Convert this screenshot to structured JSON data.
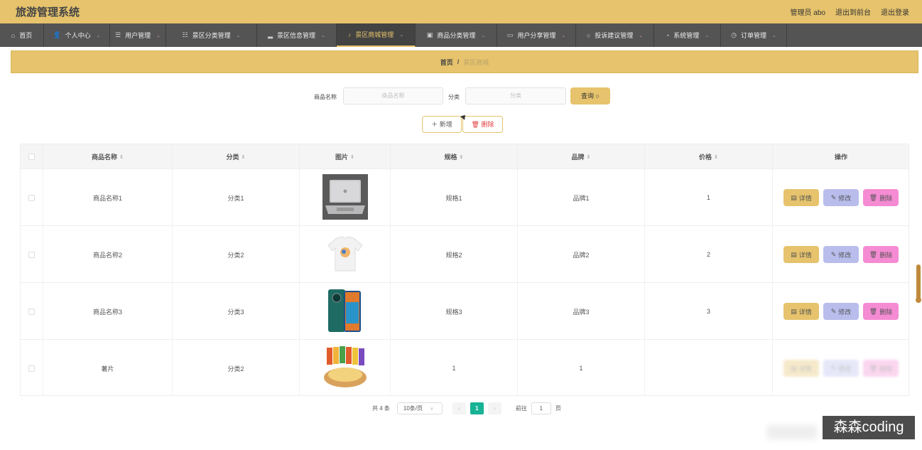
{
  "app": {
    "title": "旅游管理系统",
    "admin": "管理员 abo",
    "front": "退出到前台",
    "logout": "退出登录"
  },
  "nav": [
    {
      "label": "首页",
      "icon": "home-icon",
      "dd": false
    },
    {
      "label": "个人中心",
      "icon": "user-icon",
      "dd": true
    },
    {
      "label": "用户管理",
      "icon": "list-icon",
      "dd": true
    },
    {
      "label": "景区分类管理",
      "icon": "sliders-icon",
      "dd": true
    },
    {
      "label": "景区信息管理",
      "icon": "chart-icon",
      "dd": true
    },
    {
      "label": "景区商城管理",
      "icon": "mic-icon",
      "dd": true
    },
    {
      "label": "商品分类管理",
      "icon": "box-icon",
      "dd": true
    },
    {
      "label": "用户分享管理",
      "icon": "briefcase-icon",
      "dd": true
    },
    {
      "label": "投诉建议管理",
      "icon": "circle-icon",
      "dd": true
    },
    {
      "label": "系统管理",
      "icon": "gauge-icon",
      "dd": true
    },
    {
      "label": "订单管理",
      "icon": "clock-icon",
      "dd": true
    }
  ],
  "breadcrumb": {
    "home": "首页",
    "sep": "/",
    "current": "景区商城"
  },
  "search": {
    "name_label": "商品名称",
    "name_placeholder": "商品名称",
    "cat_label": "分类",
    "cat_placeholder": "分类",
    "button": "查询 ○"
  },
  "actions": {
    "add": "＋ 新增",
    "delete": "🗑 删除"
  },
  "table": {
    "headers": [
      "商品名称",
      "分类",
      "图片",
      "规格",
      "品牌",
      "价格",
      "操作"
    ],
    "rows": [
      {
        "name": "商品名称1",
        "category": "分类1",
        "image": "laptop",
        "spec": "规格1",
        "brand": "品牌1",
        "price": "1"
      },
      {
        "name": "商品名称2",
        "category": "分类2",
        "image": "tshirt",
        "spec": "规格2",
        "brand": "品牌2",
        "price": "2"
      },
      {
        "name": "商品名称3",
        "category": "分类3",
        "image": "phone",
        "spec": "规格3",
        "brand": "品牌3",
        "price": "3"
      },
      {
        "name": "薯片",
        "category": "分类2",
        "image": "chips",
        "spec": "1",
        "brand": "1",
        "price": ""
      }
    ],
    "ops": {
      "detail": "详情",
      "edit": "修改",
      "delete": "删除"
    }
  },
  "pager": {
    "total": "共 4 条",
    "size": "10条/页",
    "current": "1",
    "goto": "前往",
    "page_input": "1",
    "page_unit": "页"
  },
  "watermark": "森森coding"
}
